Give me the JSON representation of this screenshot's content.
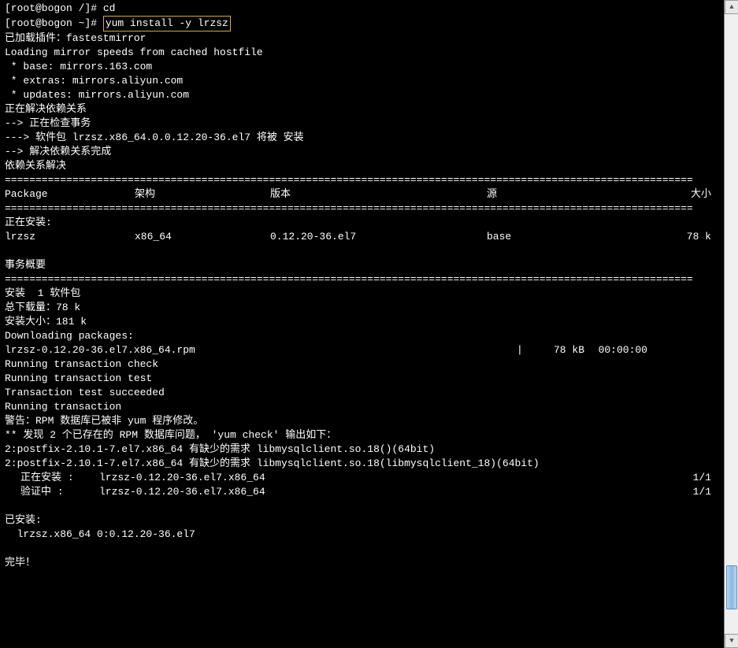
{
  "prompt1": "[root@bogon /]# cd",
  "prompt2_prefix": "[root@bogon ~]# ",
  "prompt2_cmd": "yum install -y lrzsz",
  "lines_pre": [
    "已加载插件：fastestmirror",
    "Loading mirror speeds from cached hostfile",
    " * base: mirrors.163.com",
    " * extras: mirrors.aliyun.com",
    " * updates: mirrors.aliyun.com",
    "正在解决依赖关系",
    "--> 正在检查事务",
    "---> 软件包 lrzsz.x86_64.0.0.12.20-36.el7 将被 安装",
    "--> 解决依赖关系完成",
    "",
    "依赖关系解决",
    ""
  ],
  "divider": "================================================================================================================",
  "table_header": {
    "package": " Package",
    "arch": "架构",
    "version": "版本",
    "repo": "源",
    "size": "大小"
  },
  "installing_label": "正在安装:",
  "table_row": {
    "package": " lrzsz",
    "arch": "x86_64",
    "version": "0.12.20-36.el7",
    "repo": "base",
    "size": "78 k"
  },
  "summary_label": "事务概要",
  "install_count": "安装  1 软件包",
  "lines_mid": [
    "",
    "总下载量：78 k",
    "安装大小：181 k",
    "Downloading packages:"
  ],
  "download": {
    "name": "lrzsz-0.12.20-36.el7.x86_64.rpm",
    "bar": "|",
    "size": "78 kB",
    "time": "00:00:00"
  },
  "lines_post": [
    "Running transaction check",
    "Running transaction test",
    "Transaction test succeeded",
    "Running transaction",
    "警告：RPM 数据库已被非 yum 程序修改。",
    "** 发现 2 个已存在的 RPM 数据库问题， 'yum check' 输出如下：",
    "2:postfix-2.10.1-7.el7.x86_64 有缺少的需求 libmysqlclient.so.18()(64bit)",
    "2:postfix-2.10.1-7.el7.x86_64 有缺少的需求 libmysqlclient.so.18(libmysqlclient_18)(64bit)"
  ],
  "install_steps": [
    {
      "label": "正在安装",
      "sep": "    : ",
      "pkg": "lrzsz-0.12.20-36.el7.x86_64",
      "count": "1/1"
    },
    {
      "label": "验证中",
      "sep": "      : ",
      "pkg": "lrzsz-0.12.20-36.el7.x86_64",
      "count": "1/1"
    }
  ],
  "installed_label": "已安装:",
  "installed_pkg": "  lrzsz.x86_64 0:0.12.20-36.el7",
  "done": "完毕！"
}
